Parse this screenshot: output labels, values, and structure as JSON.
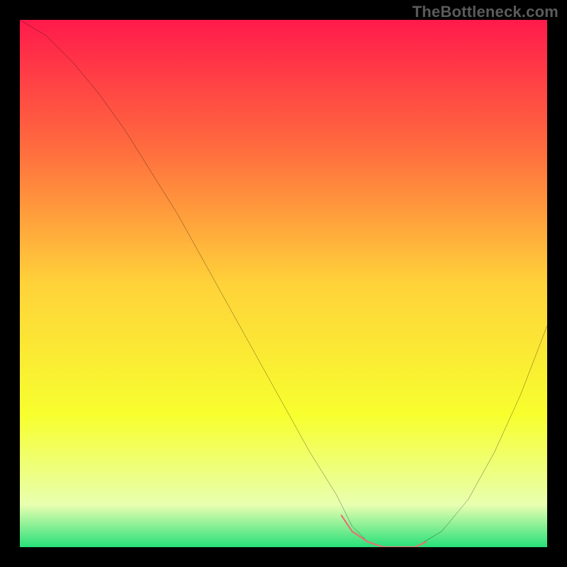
{
  "watermark": "TheBottleneck.com",
  "chart_data": {
    "type": "line",
    "title": "",
    "xlabel": "",
    "ylabel": "",
    "xlim": [
      0,
      100
    ],
    "ylim": [
      0,
      100
    ],
    "series": [
      {
        "name": "bottleneck-curve",
        "x": [
          0,
          5,
          10,
          15,
          20,
          25,
          30,
          35,
          40,
          45,
          50,
          55,
          60,
          63,
          66,
          69,
          72,
          75,
          80,
          85,
          90,
          95,
          100
        ],
        "values": [
          100,
          97,
          92,
          86,
          79,
          71,
          63,
          54,
          45,
          36,
          27,
          18,
          10,
          4,
          1,
          0,
          0,
          0,
          3,
          9,
          18,
          29,
          42
        ]
      },
      {
        "name": "optimal-marker",
        "x": [
          61,
          63,
          66,
          69,
          72,
          75,
          77
        ],
        "values": [
          6,
          3,
          1,
          0,
          0,
          0,
          1
        ]
      }
    ],
    "colors": {
      "curve": "#000000",
      "marker": "#e57373",
      "gradient_stops": [
        {
          "pos": 0.0,
          "color": "#ff1a4b"
        },
        {
          "pos": 0.25,
          "color": "#ff6e3e"
        },
        {
          "pos": 0.5,
          "color": "#ffd23a"
        },
        {
          "pos": 0.75,
          "color": "#f7ff2e"
        },
        {
          "pos": 0.92,
          "color": "#e8ffb0"
        },
        {
          "pos": 1.0,
          "color": "#28e07a"
        }
      ]
    }
  }
}
